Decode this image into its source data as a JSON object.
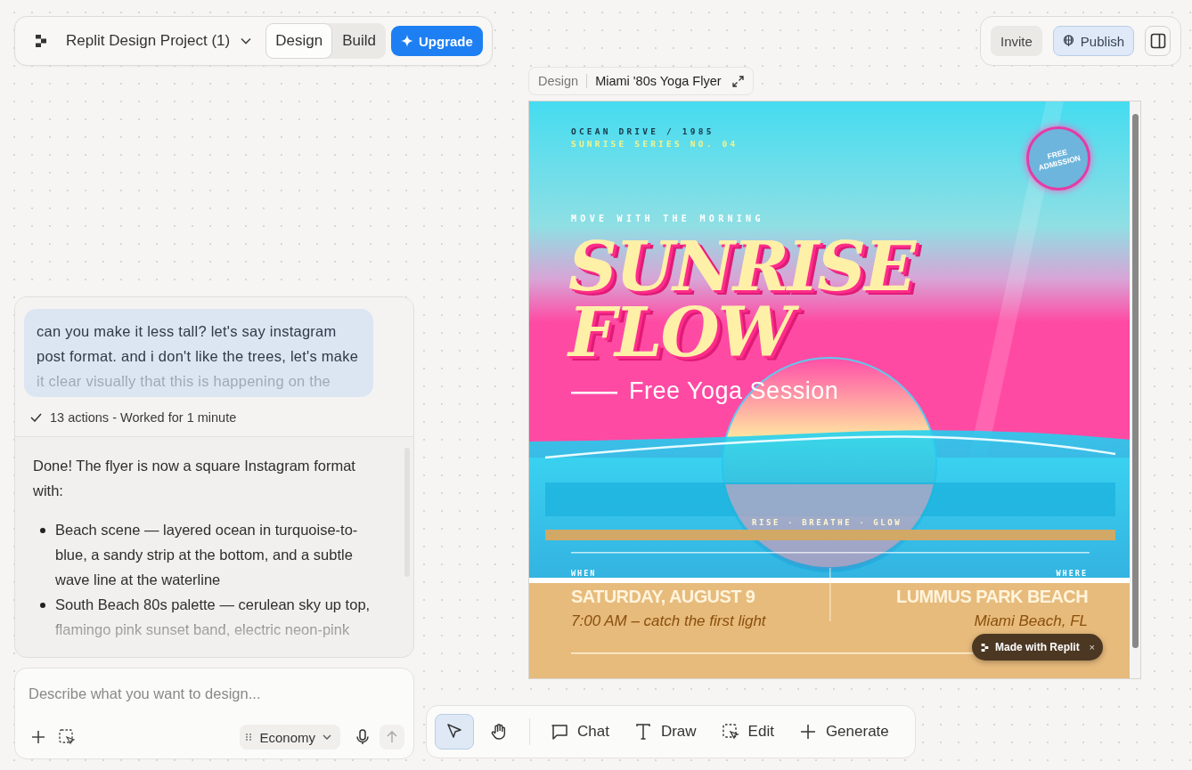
{
  "app_bar": {
    "project_name": "Replit Design Project (1)",
    "mode_tabs": [
      {
        "label": "Design",
        "selected": true
      },
      {
        "label": "Build",
        "selected": false
      }
    ],
    "upgrade_button": "Upgrade"
  },
  "top_right": {
    "invite_button": "Invite",
    "publish_button": "Publish"
  },
  "chat": {
    "user_message": "can you make it less tall? let's say instagram post format. and i don't like the trees, let's make it clear visually that this is happening on the",
    "actions_summary": "13 actions - Worked for 1 minute",
    "reply_intro": "Done! The flyer is now a square Instagram format with:",
    "reply_bullets": [
      "Beach scene — layered ocean in turquoise-to-blue, a sandy strip at the bottom, and a subtle wave line at the waterline",
      "South Beach 80s palette — cerulean sky up top, flamingo pink sunset band, electric neon-pink"
    ]
  },
  "composer": {
    "placeholder": "Describe what you want to design...",
    "model": "Economy"
  },
  "canvas": {
    "breadcrumb": "Design",
    "frame_title": "Miami '80s Yoga Flyer"
  },
  "flyer": {
    "location_line": "OCEAN DRIVE / 1985",
    "series_line": "SUNRISE SERIES NO. 04",
    "stamp": "FREE ADMISSION",
    "kicker": "MOVE WITH THE MORNING",
    "title_lines": [
      "SUNRISE",
      "FLOW"
    ],
    "subtitle": "Free Yoga Session",
    "motto": "RISE · BREATHE · GLOW",
    "when_label": "WHEN",
    "when_value": "SATURDAY, AUGUST 9",
    "when_detail": "7:00 AM – catch the first light",
    "where_label": "WHERE",
    "where_value": "LUMMUS PARK BEACH",
    "where_detail": "Miami Beach, FL",
    "made_with_badge": "Made with Replit",
    "badge_close": "×"
  },
  "toolbar": {
    "tools": [
      {
        "kind": "select",
        "selected": true
      },
      {
        "kind": "pan",
        "selected": false
      },
      {
        "kind": "chat",
        "label": "Chat",
        "selected": false
      },
      {
        "kind": "draw",
        "label": "Draw",
        "selected": false
      },
      {
        "kind": "edit",
        "label": "Edit",
        "selected": false
      },
      {
        "kind": "generate",
        "label": "Generate",
        "selected": false
      }
    ]
  }
}
